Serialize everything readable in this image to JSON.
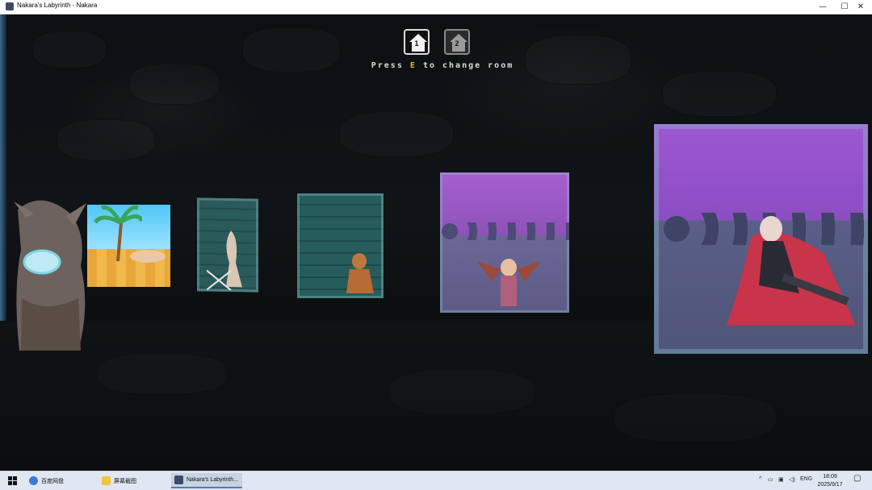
{
  "window": {
    "title": "Nakara's Labyrinth - Nakara",
    "minimize_glyph": "—",
    "maximize_glyph": "☐",
    "close_glyph": "✕"
  },
  "hud": {
    "rooms": [
      {
        "number": "1",
        "active": true
      },
      {
        "number": "2",
        "active": false
      }
    ],
    "hint_prefix": "Press",
    "hint_key": "E",
    "hint_suffix": "to change room"
  },
  "taskbar": {
    "start_icon": "windows-logo-icon",
    "items": [
      {
        "label": "百度网盘",
        "icon": "cloud-icon"
      },
      {
        "label": "屏幕截图",
        "icon": "folder-icon"
      },
      {
        "label": "Nakara's Labyrinth...",
        "icon": "game-icon",
        "active": true
      }
    ],
    "language": "ENG",
    "time": "18:09",
    "date": "2025/9/17"
  },
  "colors": {
    "accent_key": "#f2b21a",
    "taskbar_bg": "#dfe7f2"
  }
}
